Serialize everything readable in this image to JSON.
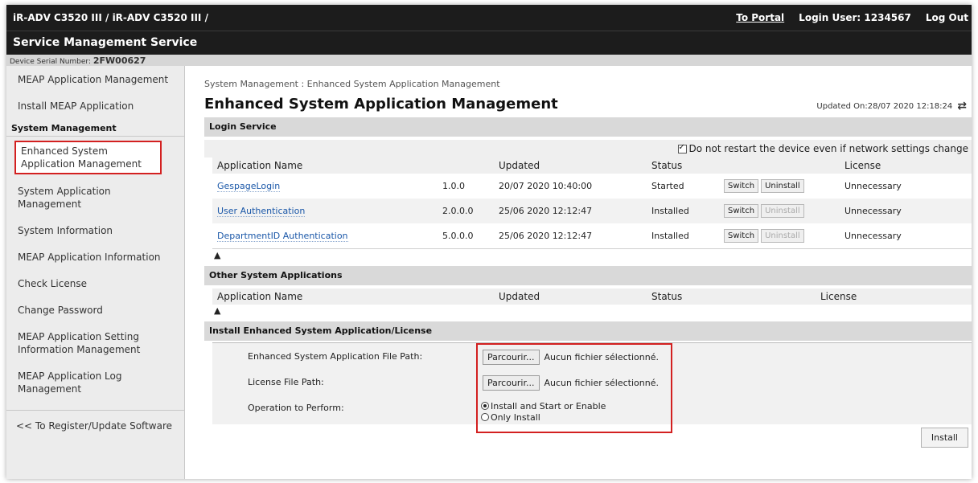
{
  "header": {
    "breadcrumb": "iR-ADV C3520 III / iR-ADV C3520 III /",
    "to_portal": "To Portal",
    "login_user": "Login User:  1234567",
    "logout": "Log Out",
    "service_title": "Service Management Service",
    "serial_label": "Device Serial Number:",
    "serial_value": "2FW00627"
  },
  "sidebar": {
    "item_meap_mgmt": "MEAP Application Management",
    "item_install_meap": "Install MEAP Application",
    "section_system": "System Management",
    "item_enhanced": "Enhanced System Application Management",
    "item_system_app": "System Application Management",
    "item_system_info": "System Information",
    "item_meap_info": "MEAP Application Information",
    "item_check_license": "Check License",
    "item_change_password": "Change Password",
    "item_meap_setting": "MEAP Application Setting Information Management",
    "item_meap_log": "MEAP Application Log Management",
    "link_register": "<< To Register/Update Software"
  },
  "main": {
    "breadcrumb": "System Management : Enhanced System Application Management",
    "title": "Enhanced System Application Management",
    "updated": "Updated On:28/07 2020 12:18:24",
    "login_service": {
      "header": "Login Service",
      "option_label": "Do not restart the device even if network settings change",
      "columns": {
        "name": "Application Name",
        "updated": "Updated",
        "status": "Status",
        "license": "License"
      },
      "rows": [
        {
          "name": "GespageLogin",
          "version": "1.0.0",
          "updated": "20/07 2020 10:40:00",
          "status": "Started",
          "switch": "Switch",
          "uninstall": "Uninstall",
          "license": "Unnecessary"
        },
        {
          "name": "User Authentication",
          "version": "2.0.0.0",
          "updated": "25/06 2020 12:12:47",
          "status": "Installed",
          "switch": "Switch",
          "uninstall": "Uninstall",
          "license": "Unnecessary"
        },
        {
          "name": "DepartmentID Authentication",
          "version": "5.0.0.0",
          "updated": "25/06 2020 12:12:47",
          "status": "Installed",
          "switch": "Switch",
          "uninstall": "Uninstall",
          "license": "Unnecessary"
        }
      ]
    },
    "other_apps": {
      "header": "Other System Applications",
      "columns": {
        "name": "Application Name",
        "updated": "Updated",
        "status": "Status",
        "license": "License"
      }
    },
    "install": {
      "header": "Install Enhanced System Application/License",
      "file_path_label": "Enhanced System Application File Path:",
      "license_path_label": "License File Path:",
      "operation_label": "Operation to Perform:",
      "browse_label": "Parcourir...",
      "no_file_text": "Aucun fichier sélectionné.",
      "option_install_start": "Install and Start or Enable",
      "option_only_install": "Only Install",
      "install_button": "Install"
    }
  }
}
